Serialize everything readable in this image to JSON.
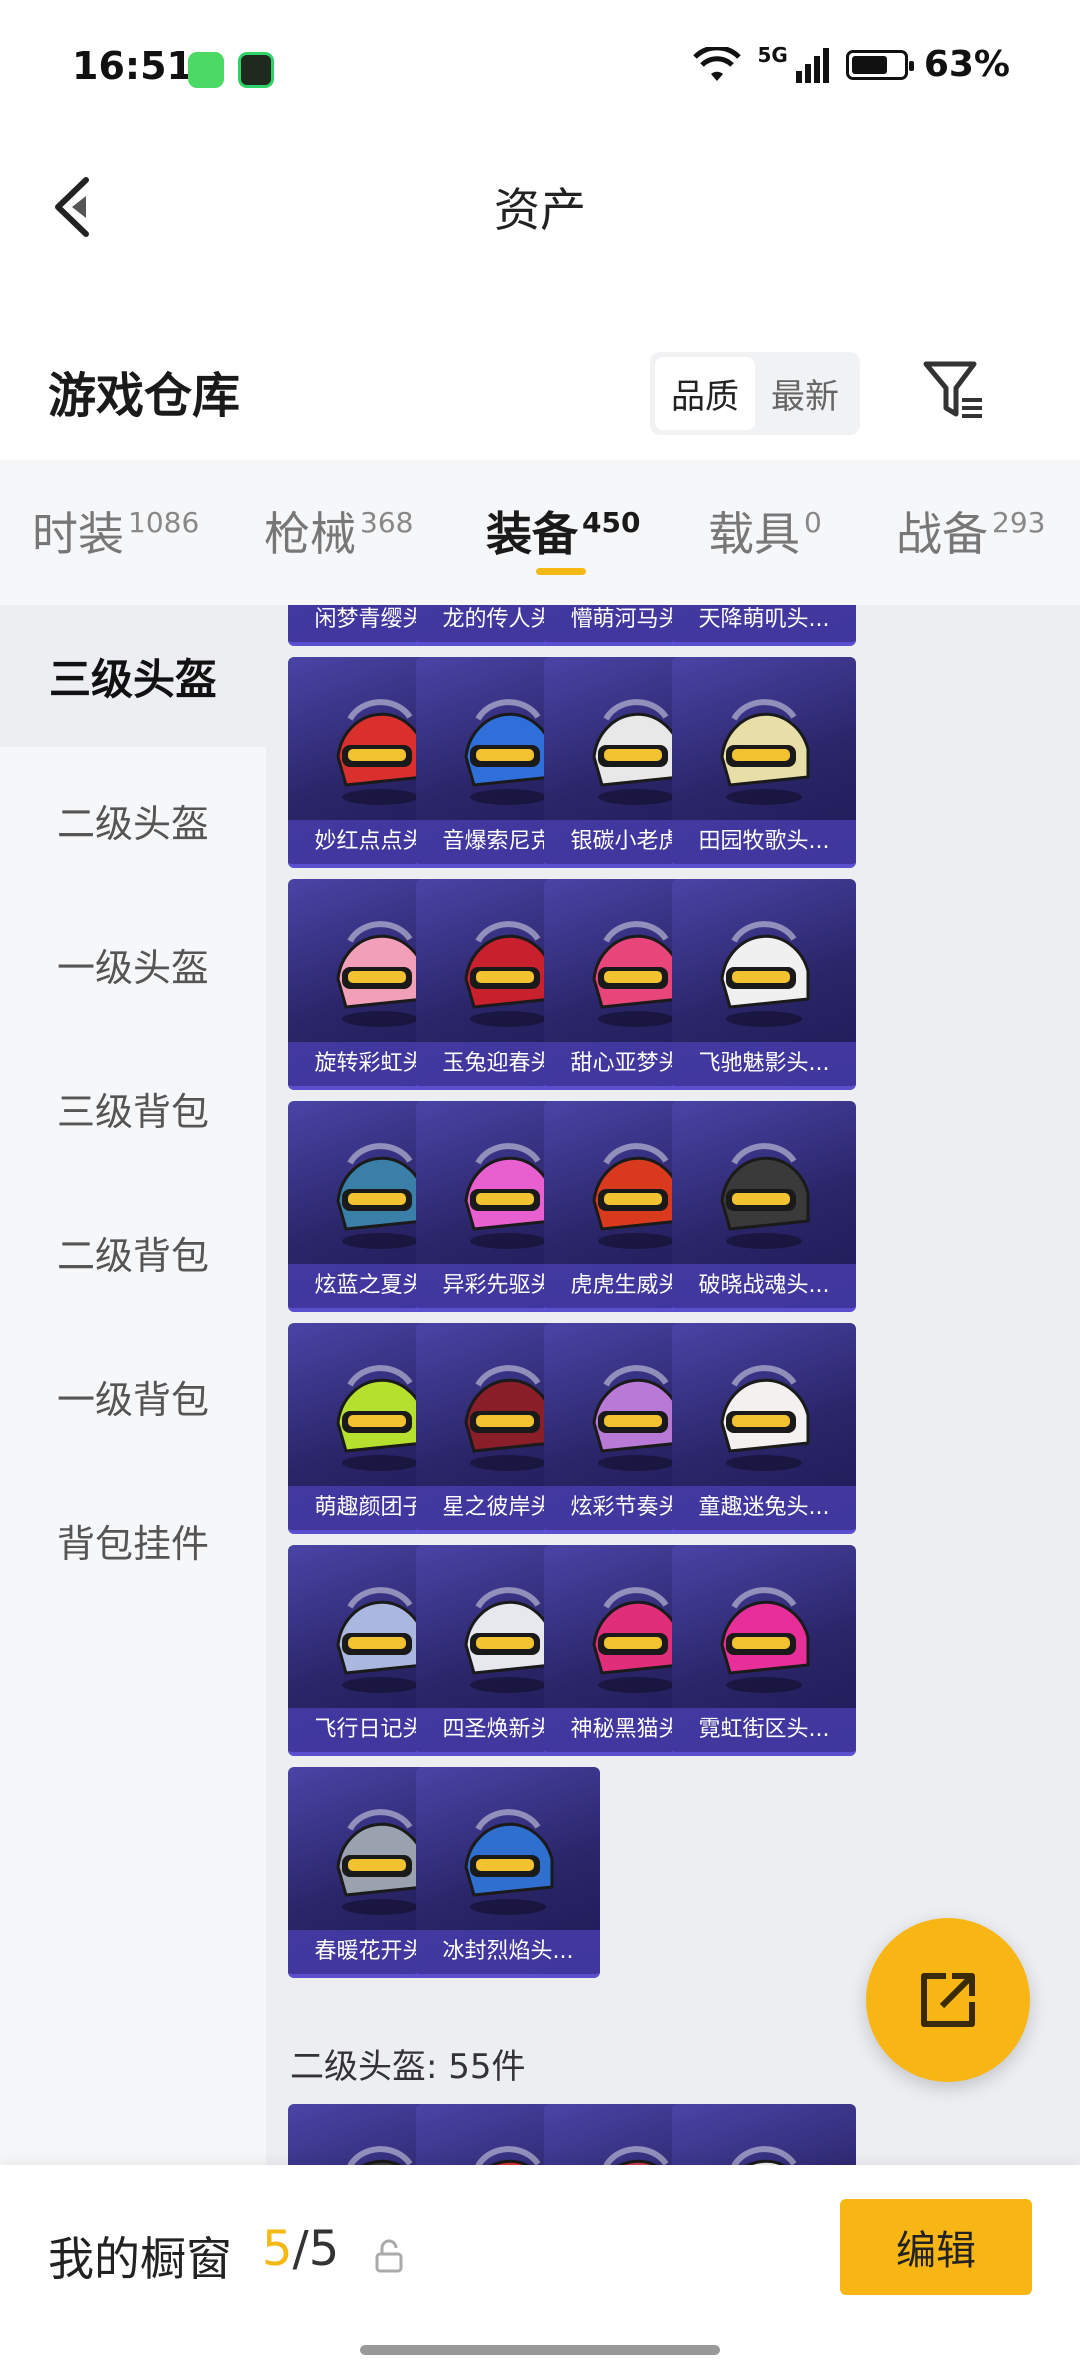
{
  "status": {
    "time": "16:51",
    "battery": "63%",
    "battery_level": 0.63,
    "network": "5G"
  },
  "title": "资产",
  "header": {
    "title": "游戏仓库",
    "sort_options": [
      "品质",
      "最新"
    ],
    "sort_selected": "品质"
  },
  "tabs": [
    {
      "label": "时装",
      "count": "1086"
    },
    {
      "label": "枪械",
      "count": "368"
    },
    {
      "label": "装备",
      "count": "450"
    },
    {
      "label": "载具",
      "count": "0"
    },
    {
      "label": "战备",
      "count": "293"
    }
  ],
  "active_tab": "装备",
  "sidebar": [
    {
      "label": "三级头盔"
    },
    {
      "label": "二级头盔"
    },
    {
      "label": "一级头盔"
    },
    {
      "label": "三级背包"
    },
    {
      "label": "二级背包"
    },
    {
      "label": "一级背包"
    },
    {
      "label": "背包挂件"
    }
  ],
  "active_sidebar": "三级头盔",
  "items": [
    {
      "name": "闲梦青缨头...",
      "color": "#9cc7e8"
    },
    {
      "name": "龙的传人头...",
      "color": "#e0b04a"
    },
    {
      "name": "懵萌河马头...",
      "color": "#d9a9d6"
    },
    {
      "name": "天降萌叽头...",
      "color": "#f2d58a"
    },
    {
      "name": "妙红点点头...",
      "color": "#d9302e"
    },
    {
      "name": "音爆索尼克...",
      "color": "#2e6fd9"
    },
    {
      "name": "银碳小老虎...",
      "color": "#e8e8e8"
    },
    {
      "name": "田园牧歌头...",
      "color": "#e8dfa8"
    },
    {
      "name": "旋转彩虹头...",
      "color": "#f2a0b8"
    },
    {
      "name": "玉兔迎春头...",
      "color": "#c8202c"
    },
    {
      "name": "甜心亚梦头...",
      "color": "#e8457a"
    },
    {
      "name": "飞驰魅影头...",
      "color": "#f0f0f0"
    },
    {
      "name": "炫蓝之夏头...",
      "color": "#3a7fa8"
    },
    {
      "name": "异彩先驱头...",
      "color": "#e85fd0"
    },
    {
      "name": "虎虎生威头...",
      "color": "#d93a1e"
    },
    {
      "name": "破晓战魂头...",
      "color": "#3a3a3a"
    },
    {
      "name": "萌趣颜团子...",
      "color": "#b6e02e"
    },
    {
      "name": "星之彼岸头...",
      "color": "#8a1f2a"
    },
    {
      "name": "炫彩节奏头...",
      "color": "#b87ad6"
    },
    {
      "name": "童趣迷兔头...",
      "color": "#f4f0f0"
    },
    {
      "name": "飞行日记头...",
      "color": "#aab8e0"
    },
    {
      "name": "四圣焕新头...",
      "color": "#e6e8ee"
    },
    {
      "name": "神秘黑猫头...",
      "color": "#e02e7a"
    },
    {
      "name": "霓虹街区头...",
      "color": "#e82e98"
    },
    {
      "name": "春暖花开头...",
      "color": "#9aa2b0"
    },
    {
      "name": "冰封烈焰头...",
      "color": "#2e6fd0"
    }
  ],
  "next_section": {
    "label": "二级头盔: 55件"
  },
  "next_items": [
    {
      "color": "#3a3a3a"
    },
    {
      "color": "#d9302e"
    },
    {
      "color": "#c83a4a"
    },
    {
      "color": "#f0f0f0"
    }
  ],
  "bottom": {
    "label": "我的橱窗",
    "used": "5",
    "slash": "/",
    "total": "5",
    "edit": "编辑"
  },
  "colors": {
    "accent": "#f7b614",
    "tile_bg": "#2a2568"
  }
}
